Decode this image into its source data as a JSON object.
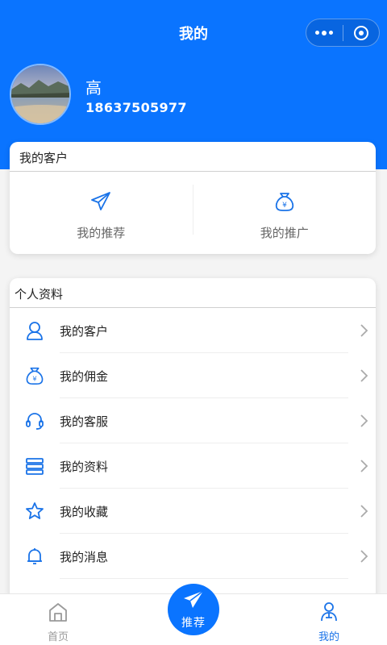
{
  "nav": {
    "title": "我的"
  },
  "profile": {
    "name": "高",
    "phone": "18637505977"
  },
  "customers_card": {
    "title": "我的客户",
    "items": [
      {
        "label": "我的推荐",
        "icon": "paper-plane-icon"
      },
      {
        "label": "我的推广",
        "icon": "money-bag-icon"
      }
    ]
  },
  "profile_card": {
    "title": "个人资料",
    "items": [
      {
        "label": "我的客户",
        "icon": "user-icon"
      },
      {
        "label": "我的佣金",
        "icon": "money-bag-icon"
      },
      {
        "label": "我的客服",
        "icon": "headset-icon"
      },
      {
        "label": "我的资料",
        "icon": "server-icon"
      },
      {
        "label": "我的收藏",
        "icon": "star-icon"
      },
      {
        "label": "我的消息",
        "icon": "bell-icon"
      }
    ]
  },
  "tabbar": {
    "home_label": "首页",
    "recommend_label": "推荐",
    "mine_label": "我的"
  },
  "colors": {
    "primary": "#0a74ff",
    "active_tab": "#1a73e8",
    "inactive_tab": "#999999"
  }
}
